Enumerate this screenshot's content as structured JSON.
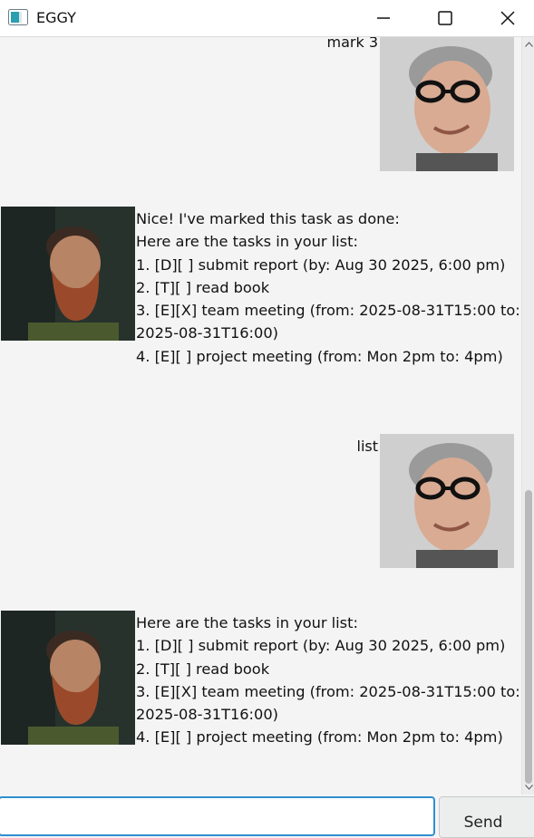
{
  "window": {
    "title": "EGGY",
    "controls": [
      "minimize",
      "maximize",
      "close"
    ]
  },
  "messages": [
    {
      "sender": "user",
      "text": "mark 3",
      "avatar": "user-avatar"
    },
    {
      "sender": "bot",
      "avatar": "bot-avatar",
      "lines": [
        "Nice! I've marked this task as done:",
        "Here are the tasks in your list:",
        "1. [D][ ] submit report (by: Aug 30 2025, 6:00 pm)",
        "2. [T][ ] read book",
        "3. [E][X] team meeting (from: 2025-08-31T15:00 to:",
        "2025-08-31T16:00)",
        "4. [E][ ] project meeting (from: Mon 2pm to: 4pm)"
      ]
    },
    {
      "sender": "user",
      "text": "list",
      "avatar": "user-avatar"
    },
    {
      "sender": "bot",
      "avatar": "bot-avatar",
      "lines": [
        "Here are the tasks in your list:",
        "1. [D][ ] submit report (by: Aug 30 2025, 6:00 pm)",
        "2. [T][ ] read book",
        "3. [E][X] team meeting (from: 2025-08-31T15:00 to:",
        "2025-08-31T16:00)",
        "4. [E][ ] project meeting (from: Mon 2pm to: 4pm)"
      ]
    }
  ],
  "input": {
    "value": "",
    "placeholder": ""
  },
  "send_button": {
    "label": "Send"
  },
  "colors": {
    "background": "#f4f4f4",
    "input_focus_border": "#2f8fd0",
    "scroll_thumb": "#b9b9b9"
  }
}
